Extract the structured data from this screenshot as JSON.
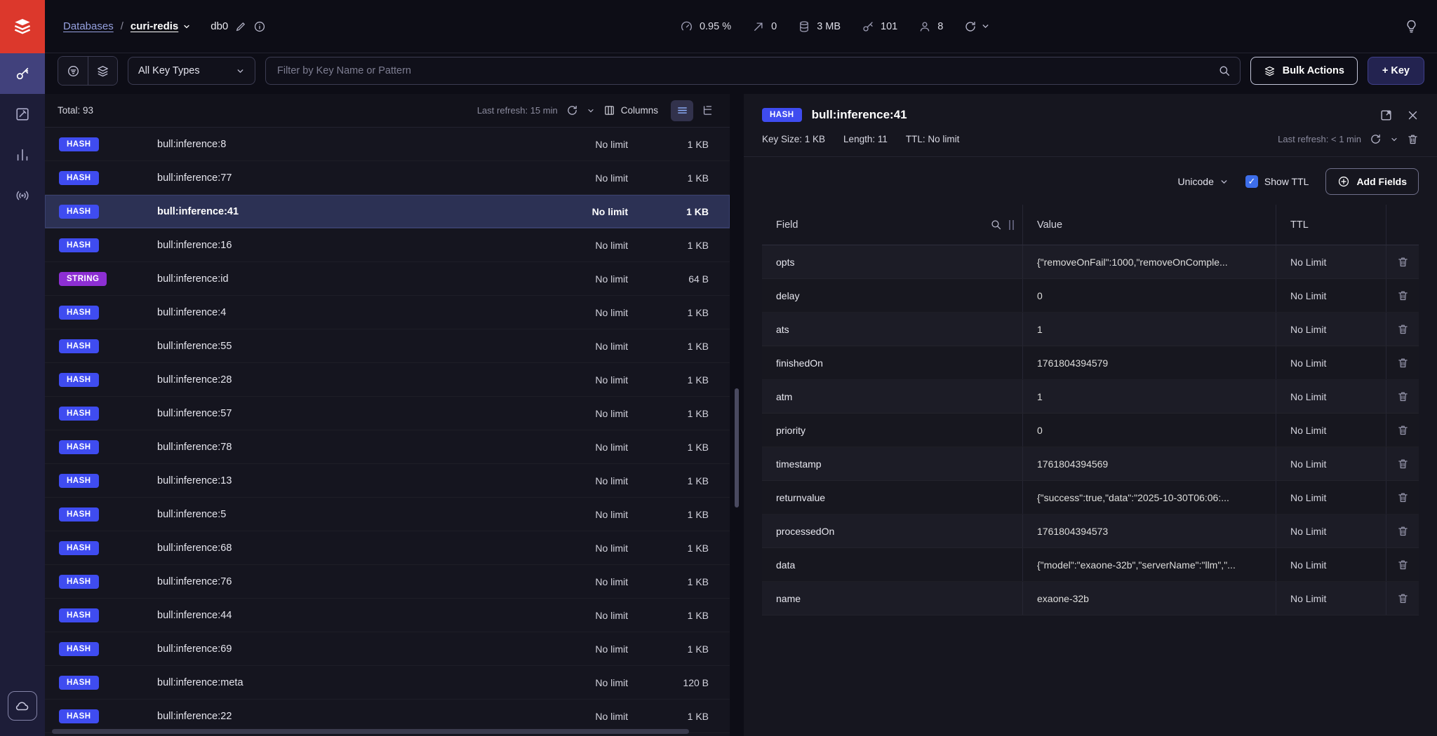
{
  "topbar": {
    "breadcrumb": {
      "root": "Databases",
      "separator": "/",
      "database": "curi-redis",
      "db_index": "db0"
    },
    "metrics": {
      "cpu": "0.95 %",
      "commands": "0",
      "memory": "3 MB",
      "keys": "101",
      "clients": "8"
    }
  },
  "filterbar": {
    "key_type_filter": "All Key Types",
    "search_placeholder": "Filter by Key Name or Pattern",
    "bulk_actions_label": "Bulk Actions",
    "add_key_label": "+ Key"
  },
  "key_list": {
    "total": "Total: 93",
    "last_refresh": "Last refresh: 15 min",
    "columns_label": "Columns",
    "rows": [
      {
        "type": "HASH",
        "name": "bull:inference:8",
        "limit": "No limit",
        "size": "1 KB"
      },
      {
        "type": "HASH",
        "name": "bull:inference:77",
        "limit": "No limit",
        "size": "1 KB"
      },
      {
        "type": "HASH",
        "name": "bull:inference:41",
        "limit": "No limit",
        "size": "1 KB",
        "selected": true
      },
      {
        "type": "HASH",
        "name": "bull:inference:16",
        "limit": "No limit",
        "size": "1 KB"
      },
      {
        "type": "STRING",
        "name": "bull:inference:id",
        "limit": "No limit",
        "size": "64 B"
      },
      {
        "type": "HASH",
        "name": "bull:inference:4",
        "limit": "No limit",
        "size": "1 KB"
      },
      {
        "type": "HASH",
        "name": "bull:inference:55",
        "limit": "No limit",
        "size": "1 KB"
      },
      {
        "type": "HASH",
        "name": "bull:inference:28",
        "limit": "No limit",
        "size": "1 KB"
      },
      {
        "type": "HASH",
        "name": "bull:inference:57",
        "limit": "No limit",
        "size": "1 KB"
      },
      {
        "type": "HASH",
        "name": "bull:inference:78",
        "limit": "No limit",
        "size": "1 KB"
      },
      {
        "type": "HASH",
        "name": "bull:inference:13",
        "limit": "No limit",
        "size": "1 KB"
      },
      {
        "type": "HASH",
        "name": "bull:inference:5",
        "limit": "No limit",
        "size": "1 KB"
      },
      {
        "type": "HASH",
        "name": "bull:inference:68",
        "limit": "No limit",
        "size": "1 KB"
      },
      {
        "type": "HASH",
        "name": "bull:inference:76",
        "limit": "No limit",
        "size": "1 KB"
      },
      {
        "type": "HASH",
        "name": "bull:inference:44",
        "limit": "No limit",
        "size": "1 KB"
      },
      {
        "type": "HASH",
        "name": "bull:inference:69",
        "limit": "No limit",
        "size": "1 KB"
      },
      {
        "type": "HASH",
        "name": "bull:inference:meta",
        "limit": "No limit",
        "size": "120 B"
      },
      {
        "type": "HASH",
        "name": "bull:inference:22",
        "limit": "No limit",
        "size": "1 KB"
      }
    ]
  },
  "key_details": {
    "type_badge": "HASH",
    "title": "bull:inference:41",
    "key_size": "Key Size: 1 KB",
    "length": "Length: 11",
    "ttl": "TTL:  No limit",
    "last_refresh": "Last refresh: < 1 min",
    "encoding": "Unicode",
    "show_ttl_label": "Show TTL",
    "add_fields_label": "Add Fields",
    "table": {
      "headers": {
        "field": "Field",
        "value": "Value",
        "ttl": "TTL"
      },
      "rows": [
        {
          "field": "opts",
          "value": "{\"removeOnFail\":1000,\"removeOnComple...",
          "ttl": "No Limit"
        },
        {
          "field": "delay",
          "value": "0",
          "ttl": "No Limit"
        },
        {
          "field": "ats",
          "value": "1",
          "ttl": "No Limit"
        },
        {
          "field": "finishedOn",
          "value": "1761804394579",
          "ttl": "No Limit"
        },
        {
          "field": "atm",
          "value": "1",
          "ttl": "No Limit"
        },
        {
          "field": "priority",
          "value": "0",
          "ttl": "No Limit"
        },
        {
          "field": "timestamp",
          "value": "1761804394569",
          "ttl": "No Limit"
        },
        {
          "field": "returnvalue",
          "value": "{\"success\":true,\"data\":\"2025-10-30T06:06:...",
          "ttl": "No Limit"
        },
        {
          "field": "processedOn",
          "value": "1761804394573",
          "ttl": "No Limit"
        },
        {
          "field": "data",
          "value": "{\"model\":\"exaone-32b\",\"serverName\":\"llm\",\"...",
          "ttl": "No Limit"
        },
        {
          "field": "name",
          "value": "exaone-32b",
          "ttl": "No Limit"
        }
      ]
    }
  },
  "icons": {
    "redis_logo": "red-cube-stack",
    "browse": "key",
    "workbench": "pencil-square",
    "analytics": "bar-chart",
    "pubsub": "broadcast",
    "cloud": "cloud",
    "cpu": "gauge",
    "commands": "arrow-up-right",
    "memory": "database",
    "keys": "key",
    "clients": "person",
    "refresh": "circular-arrow",
    "chevron": "chevron-down",
    "lightbulb": "bulb",
    "search": "magnifier",
    "trash": "bin",
    "close": "x",
    "fullscreen": "expand-corners",
    "columns": "grid",
    "checkbox_check": "✓",
    "add": "plus-circle",
    "edit": "pencil",
    "info": "info-circle",
    "layers": "stack"
  }
}
